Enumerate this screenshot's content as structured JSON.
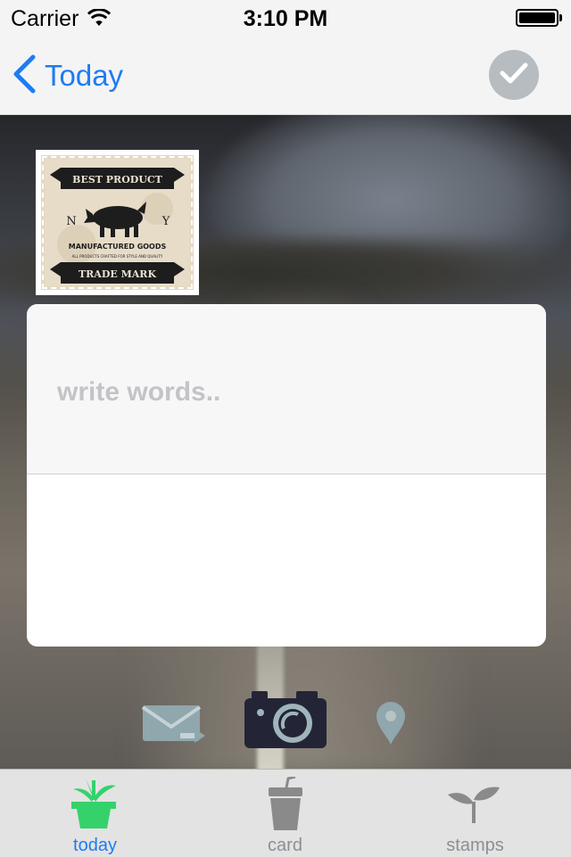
{
  "status_bar": {
    "carrier": "Carrier",
    "time": "3:10 PM"
  },
  "nav": {
    "back_label": "Today",
    "done_icon": "checkmark-icon"
  },
  "stamp": {
    "banner_top": "BEST PRODUCT",
    "left_letter": "N",
    "right_letter": "Y",
    "line1": "MANUFACTURED GOODS",
    "line2": "ALL PRODUCTS CRAFTED FOR STYLE AND QUALITY",
    "banner_bottom": "TRADE MARK"
  },
  "note": {
    "placeholder": "write words..",
    "value": ""
  },
  "actions": [
    {
      "icon": "send-mail-icon"
    },
    {
      "icon": "camera-icon"
    },
    {
      "icon": "location-pin-icon"
    }
  ],
  "tabs": [
    {
      "label": "today",
      "icon": "plant-pot-icon",
      "active": true
    },
    {
      "label": "card",
      "icon": "cup-icon",
      "active": false
    },
    {
      "label": "stamps",
      "icon": "sprout-icon",
      "active": false
    }
  ],
  "colors": {
    "accent": "#1e7cf2",
    "active_tab_icon": "#35d26b",
    "inactive_tab_icon": "#8a8a8a"
  }
}
